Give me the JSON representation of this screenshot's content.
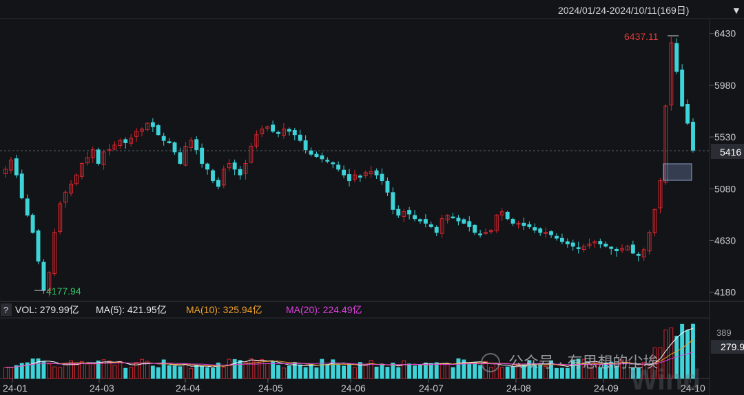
{
  "header": {
    "date_range": "2024/01/24-2024/10/11(169日)",
    "dropdown_icon": "triangle-down-icon"
  },
  "price_panel": {
    "current_price_label": "5416",
    "high_label": "6437.11",
    "low_label": "4177.94"
  },
  "volume_panel": {
    "help_label": "?",
    "vol_label": "VOL: 279.99亿",
    "ma5_label": "MA(5): 421.95亿",
    "ma10_label": "MA(10): 325.94亿",
    "ma20_label": "MA(20): 224.49亿",
    "right_value_label": "279.9",
    "right_partial_label": "389"
  },
  "watermark": {
    "text": "公众号 · 有思想的尘埃",
    "brand": "Wind"
  },
  "colors": {
    "background": "#121417",
    "up": "#d8262f",
    "down": "#3ed3d8",
    "high_text": "#e23a3a",
    "low_text": "#34c76a",
    "ma5": "#ffffff",
    "ma10": "#f0a028",
    "ma20": "#e040e0",
    "axis_text": "#c8cdd2",
    "grid": "#2a2e34"
  },
  "chart_data": [
    {
      "type": "candlestick",
      "title": "",
      "x_ticks": [
        "24-01",
        "24-03",
        "24-04",
        "24-05",
        "24-06",
        "24-07",
        "24-08",
        "24-09",
        "24-10"
      ],
      "y_ticks": [
        4180,
        4630,
        5080,
        5530,
        5980,
        6430
      ],
      "ylim": [
        4100,
        6560
      ],
      "current_price": 5416,
      "max_point": {
        "value": 6437.11,
        "label": "6437.11"
      },
      "min_point": {
        "value": 4177.94,
        "label": "4177.94"
      },
      "close_path_approx": [
        5250,
        5330,
        5200,
        5000,
        4850,
        4700,
        4450,
        4200,
        4350,
        4700,
        4950,
        5050,
        5120,
        5200,
        5300,
        5350,
        5420,
        5300,
        5400,
        5420,
        5460,
        5500,
        5480,
        5520,
        5580,
        5600,
        5650,
        5620,
        5550,
        5500,
        5480,
        5400,
        5300,
        5450,
        5500,
        5420,
        5300,
        5250,
        5150,
        5100,
        5250,
        5300,
        5250,
        5200,
        5300,
        5450,
        5550,
        5600,
        5620,
        5580,
        5560,
        5600,
        5580,
        5550,
        5500,
        5420,
        5380,
        5360,
        5340,
        5320,
        5300,
        5250,
        5200,
        5150,
        5200,
        5180,
        5220,
        5230,
        5200,
        5150,
        5050,
        4900,
        4850,
        4880,
        4860,
        4820,
        4800,
        4780,
        4750,
        4700,
        4820,
        4850,
        4830,
        4800,
        4780,
        4750,
        4700,
        4680,
        4700,
        4720,
        4850,
        4880,
        4820,
        4780,
        4780,
        4760,
        4750,
        4720,
        4700,
        4700,
        4680,
        4650,
        4620,
        4600,
        4580,
        4560,
        4580,
        4600,
        4620,
        4600,
        4580,
        4560,
        4540,
        4560,
        4580,
        4520,
        4500,
        4550,
        4700,
        4900,
        5150,
        5800,
        6350,
        6100,
        5800,
        5650,
        5416
      ],
      "volume": {
        "labels": [
          "VOL: 279.99亿",
          "MA(5): 421.95亿",
          "MA(10): 325.94亿",
          "MA(20): 224.49亿"
        ],
        "current": 279.99,
        "ma5": 421.95,
        "ma10": 325.94,
        "ma20": 224.49
      }
    }
  ]
}
